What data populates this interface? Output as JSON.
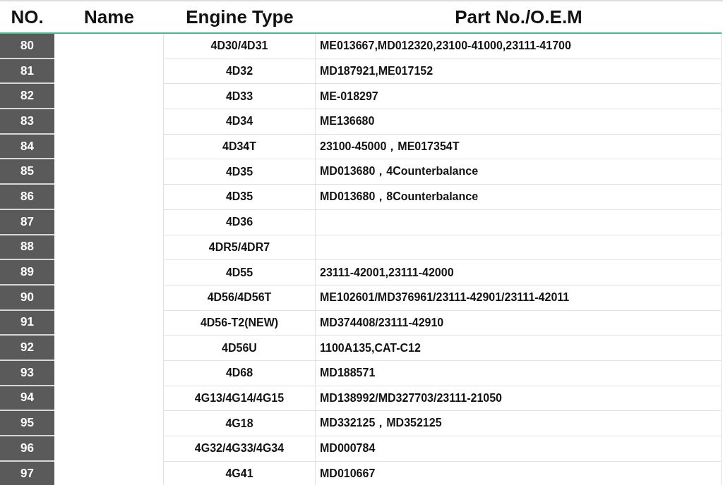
{
  "columns": [
    "NO.",
    "Name",
    "Engine Type",
    "Part No./O.E.M"
  ],
  "rows": [
    {
      "no": "80",
      "engine": "4D30/4D31",
      "part": "ME013667,MD012320,23100-41000,23111-41700"
    },
    {
      "no": "81",
      "engine": "4D32",
      "part": "MD187921,ME017152"
    },
    {
      "no": "82",
      "engine": "4D33",
      "part": "ME-018297"
    },
    {
      "no": "83",
      "engine": "4D34",
      "part": "ME136680"
    },
    {
      "no": "84",
      "engine": "4D34T",
      "part": "23100-45000，ME017354T"
    },
    {
      "no": "85",
      "engine": "4D35",
      "part": "MD013680，4Counterbalance"
    },
    {
      "no": "86",
      "engine": "4D35",
      "part": "MD013680，8Counterbalance"
    },
    {
      "no": "87",
      "engine": "4D36"
    },
    {
      "no": "88",
      "engine": "4DR5/4DR7"
    },
    {
      "no": "89",
      "engine": "4D55",
      "part": "23111-42001,23111-42000"
    },
    {
      "no": "90",
      "engine": "4D56/4D56T",
      "part": "ME102601/MD376961/23111-42901/23111-42011"
    },
    {
      "no": "91",
      "engine": "4D56-T2(NEW)",
      "part": "MD374408/23111-42910"
    },
    {
      "no": "92",
      "engine": "4D56U",
      "part": "1100A135,CAT-C12"
    },
    {
      "no": "93",
      "engine": "4D68",
      "part": "MD188571"
    },
    {
      "no": "94",
      "engine": "4G13/4G14/4G15",
      "part": "MD138992/MD327703/23111-21050"
    },
    {
      "no": "95",
      "engine": "4G18",
      "part": "MD332125，MD352125"
    },
    {
      "no": "96",
      "engine": "4G32/4G33/4G34",
      "part": "MD000784"
    },
    {
      "no": "97",
      "engine": "4G41",
      "part": "MD010667"
    }
  ]
}
